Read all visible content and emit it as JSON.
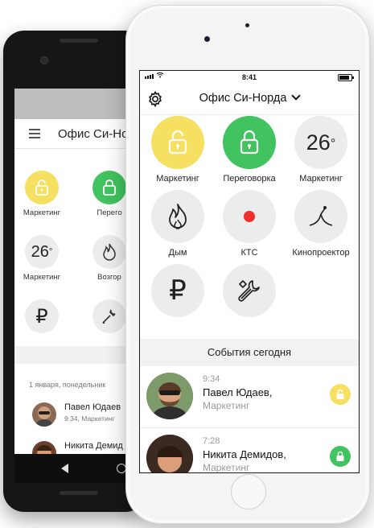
{
  "android": {
    "title": "Офис Си-Нор",
    "tiles": [
      {
        "label": "Маркетинг",
        "kind": "lock",
        "color": "#f5e062"
      },
      {
        "label": "Перего",
        "kind": "lock",
        "color": "#41c35f"
      },
      {
        "label": "Маркетинг",
        "kind": "temp",
        "value": "26"
      },
      {
        "label": "Возгор",
        "kind": "fire"
      },
      {
        "label": "",
        "kind": "ruble"
      },
      {
        "label": "",
        "kind": "wrench"
      }
    ],
    "date_header": "1 января, понедельник",
    "events": [
      {
        "name": "Павел Юдаев",
        "sub": "9:34, Маркетинг"
      },
      {
        "name": "Никита Демид",
        "sub": ""
      }
    ]
  },
  "iphone": {
    "status": {
      "time": "8:41"
    },
    "header": {
      "title": "Офис Си-Норда"
    },
    "tiles": [
      {
        "label": "Маркетинг",
        "kind": "lock-open",
        "color": "#f5e062"
      },
      {
        "label": "Переговорка",
        "kind": "lock",
        "color": "#41c35f"
      },
      {
        "label": "Маркетинг",
        "kind": "temp",
        "value": "26"
      },
      {
        "label": "Дым",
        "kind": "fire"
      },
      {
        "label": "КТС",
        "kind": "panic",
        "color": "#f02f2f"
      },
      {
        "label": "Кинопроектор",
        "kind": "projector"
      },
      {
        "label": "",
        "kind": "ruble"
      },
      {
        "label": "",
        "kind": "wrench"
      }
    ],
    "events_title": "События сегодня",
    "events": [
      {
        "time": "9:34",
        "name": "Павел Юдаев,",
        "sub": "Маркетинг",
        "lock_color": "#f5e062"
      },
      {
        "time": "7:28",
        "name": "Никита Демидов,",
        "sub": "Маркетинг",
        "lock_color": "#41c35f"
      }
    ]
  }
}
